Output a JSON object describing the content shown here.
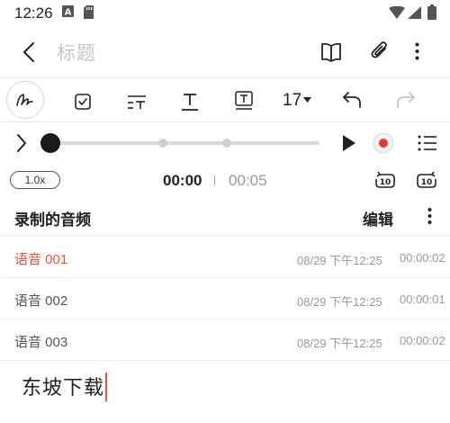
{
  "status_bar": {
    "time": "12:26"
  },
  "header": {
    "title": "标题"
  },
  "toolbar": {
    "font_size": "17"
  },
  "player": {
    "speed": "1.0x",
    "current_time": "00:00",
    "total_time": "00:05",
    "progress": 0
  },
  "recordings": {
    "title": "录制的音频",
    "edit_label": "编辑",
    "items": [
      {
        "name": "语音 001",
        "date": "08/29 下午12:25",
        "duration": "00:00:02",
        "active": true
      },
      {
        "name": "语音 002",
        "date": "08/29 下午12:25",
        "duration": "00:00:01",
        "active": false
      },
      {
        "name": "语音 003",
        "date": "08/29 下午12:25",
        "duration": "00:00:02",
        "active": false
      }
    ]
  },
  "body": {
    "text": "东坡下载"
  },
  "colors": {
    "accent": "#e9533a",
    "record_red": "#e53935"
  }
}
